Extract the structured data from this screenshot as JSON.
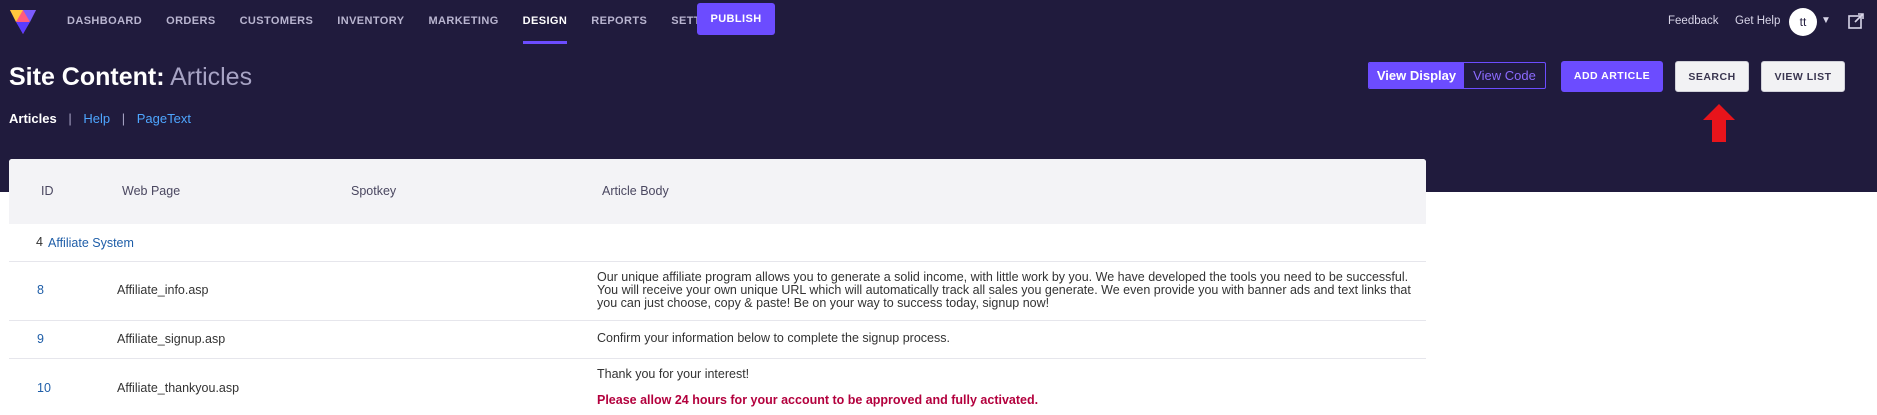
{
  "nav": {
    "links": [
      "DASHBOARD",
      "ORDERS",
      "CUSTOMERS",
      "INVENTORY",
      "MARKETING",
      "DESIGN",
      "REPORTS",
      "SETTINGS"
    ],
    "active": "DESIGN",
    "publish_label": "PUBLISH",
    "feedback_label": "Feedback",
    "help_label": "Get Help",
    "avatar_initials": "tt"
  },
  "header": {
    "title_prefix": "Site Content:",
    "title_section": "Articles",
    "view_display_label": "View Display",
    "view_code_label": "View Code",
    "add_article_label": "ADD ARTICLE",
    "search_label": "SEARCH",
    "view_list_label": "VIEW LIST"
  },
  "subnav": {
    "current": "Articles",
    "separator": "|",
    "help_label": "Help",
    "pagetext_label": "PageText"
  },
  "table": {
    "columns": [
      "ID",
      "Web Page",
      "Spotkey",
      "Article Body"
    ],
    "group": {
      "id": "4",
      "name": "Affiliate System"
    },
    "rows": [
      {
        "id": "8",
        "web_page": "Affiliate_info.asp",
        "spotkey": "",
        "body": "Our unique affiliate program allows you to generate a solid income, with little work by you. We have developed the tools you need to be successful. You will receive your own unique URL which will automatically track all sales you generate. We even provide you with banner ads and text links that you can just choose, copy & paste! Be on your way to success today, signup now!"
      },
      {
        "id": "9",
        "web_page": "Affiliate_signup.asp",
        "spotkey": "",
        "body": "Confirm your information below to complete the signup process."
      },
      {
        "id": "10",
        "web_page": "Affiliate_thankyou.asp",
        "spotkey": "",
        "body": "Thank you for your interest!",
        "body_alert": "Please allow 24 hours for your account to be approved and fully activated."
      }
    ]
  },
  "colors": {
    "header_bg": "#201b3d",
    "accent": "#6c4cff",
    "link": "#1f5ea8",
    "alert": "#b3003d",
    "annotation_arrow": "#e8141b"
  }
}
